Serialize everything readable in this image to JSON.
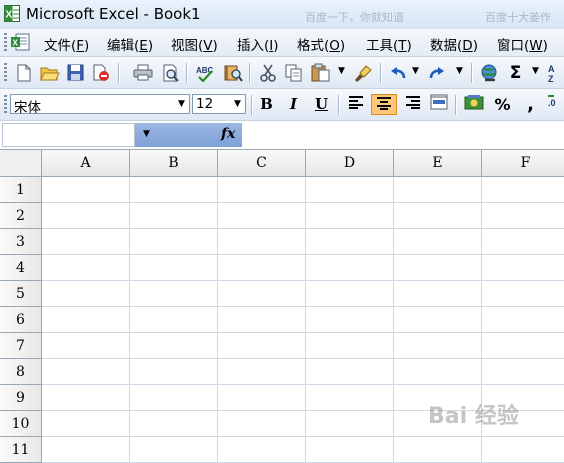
{
  "window": {
    "title": "Microsoft Excel - Book1",
    "ghost_tabs": [
      "百度一下，你就知道",
      "百度十大姜作"
    ]
  },
  "menubar": {
    "items": [
      {
        "label": "文件(",
        "key": "F",
        "end": ")"
      },
      {
        "label": "编辑(",
        "key": "E",
        "end": ")"
      },
      {
        "label": "视图(",
        "key": "V",
        "end": ")"
      },
      {
        "label": "插入(",
        "key": "I",
        "end": ")"
      },
      {
        "label": "格式(",
        "key": "O",
        "end": ")"
      },
      {
        "label": "工具(",
        "key": "T",
        "end": ")"
      },
      {
        "label": "数据(",
        "key": "D",
        "end": ")"
      },
      {
        "label": "窗口(",
        "key": "W",
        "end": ")"
      }
    ]
  },
  "standard_toolbar": {
    "icons": [
      "new-icon",
      "open-icon",
      "save-icon",
      "permission-icon",
      "print-icon",
      "print-preview-icon",
      "spelling-icon",
      "research-icon",
      "cut-icon",
      "copy-icon",
      "paste-icon",
      "format-painter-icon",
      "undo-icon",
      "redo-icon",
      "hyperlink-icon",
      "autosum-icon",
      "sort-ascending-icon"
    ],
    "autosum_glyph": "Σ"
  },
  "formatting_toolbar": {
    "font_name": "宋体",
    "font_size": "12",
    "bold": "B",
    "italic": "I",
    "underline": "U",
    "percent": "%",
    "comma": ",",
    "active_alignment": "center"
  },
  "formula_bar": {
    "name_box_value": "",
    "fx_label": "fx",
    "formula_value": ""
  },
  "sheet": {
    "columns": [
      "A",
      "B",
      "C",
      "D",
      "E",
      "F"
    ],
    "rows": [
      "1",
      "2",
      "3",
      "4",
      "5",
      "6",
      "7",
      "8",
      "9",
      "10",
      "11"
    ]
  },
  "watermark": "Bai 经验",
  "colors": {
    "title_bar": "#dbe7f6",
    "active_button": "#ffc57a",
    "namebox_bar": "#8eaedd",
    "header_border": "#9aa7b5",
    "gridline": "#d0d7e5"
  }
}
